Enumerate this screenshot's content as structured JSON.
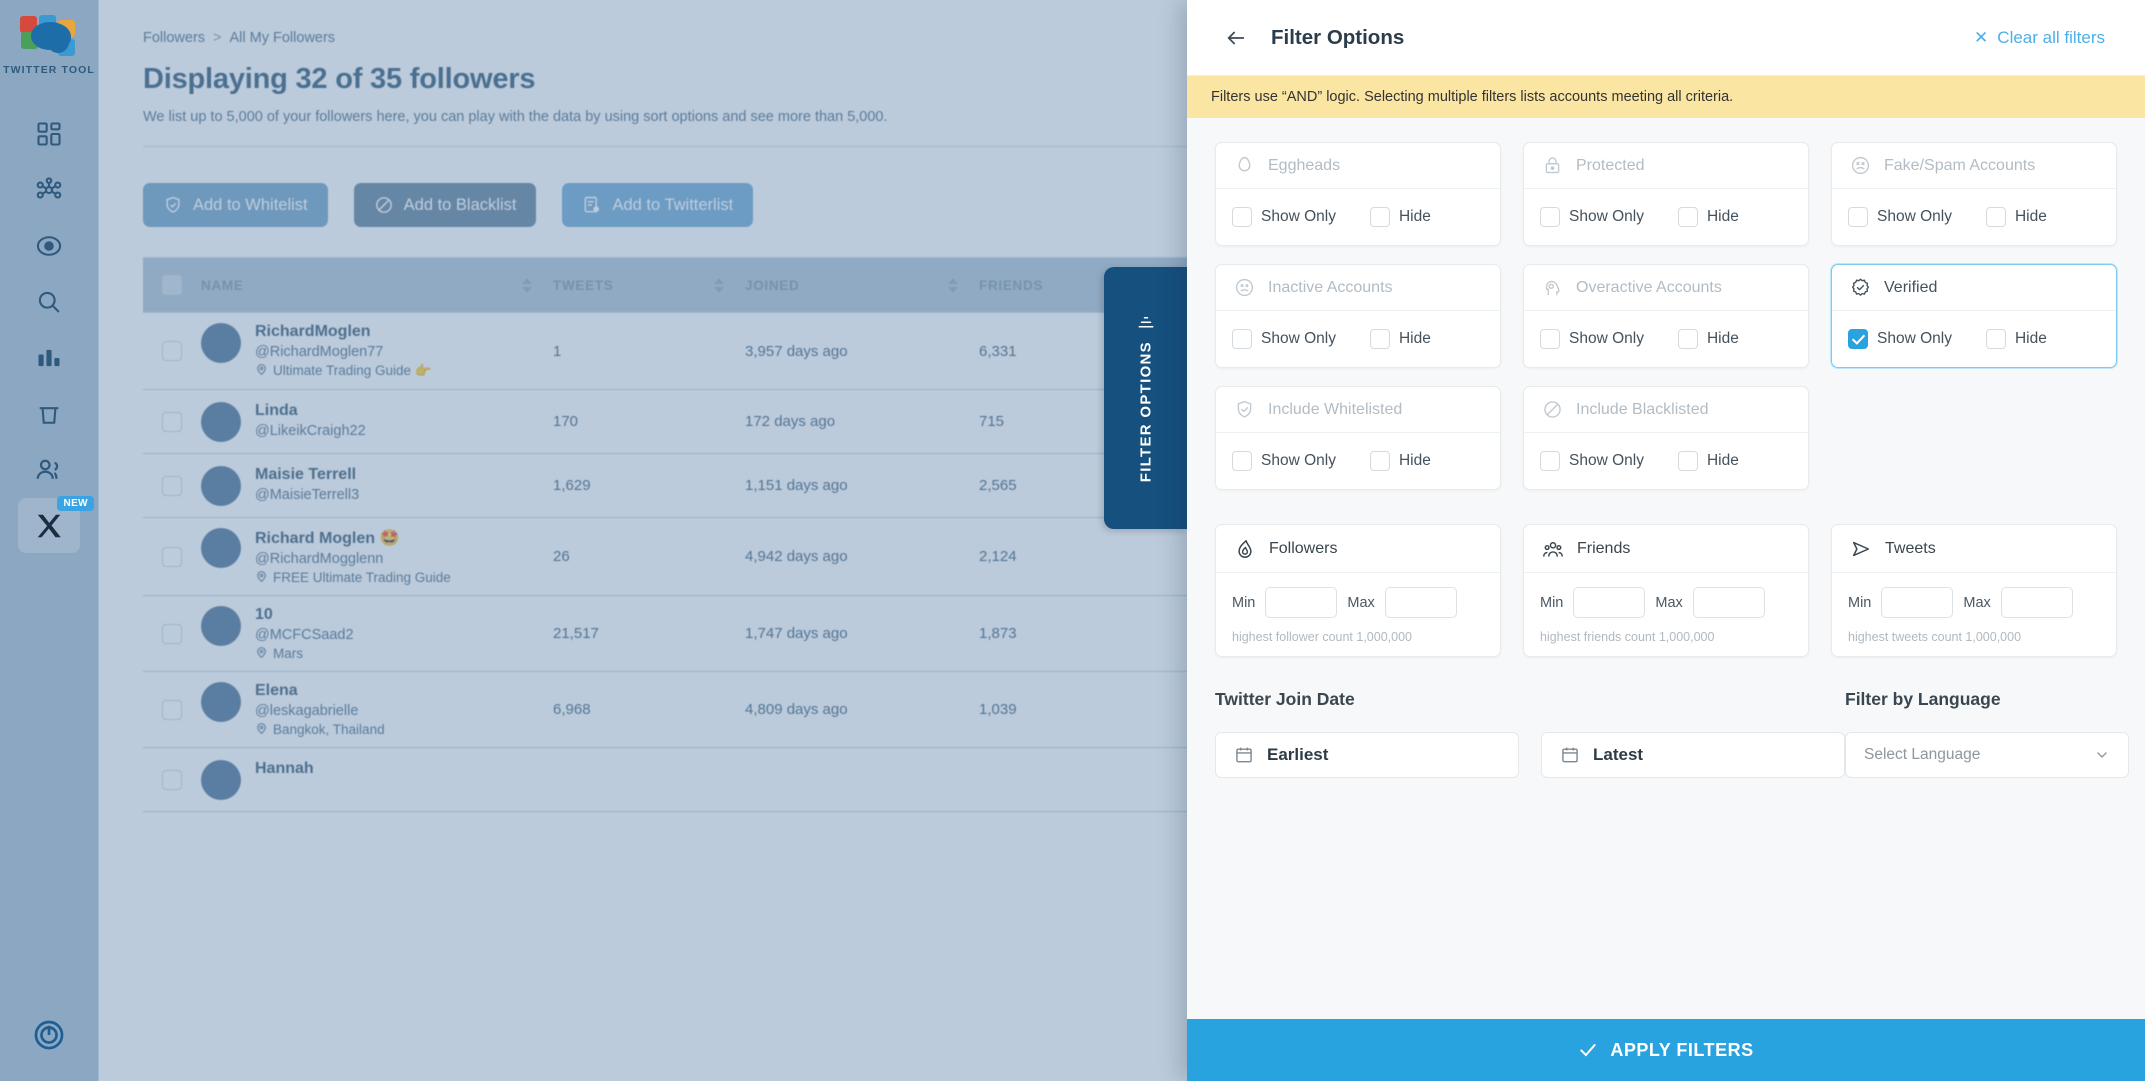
{
  "sidebar": {
    "brand": "TWITTER TOOL",
    "items": [
      {
        "name": "dashboard",
        "icon": "dashboard-icon"
      },
      {
        "name": "network",
        "icon": "network-icon"
      },
      {
        "name": "target",
        "icon": "target-icon"
      },
      {
        "name": "search",
        "icon": "search-icon"
      },
      {
        "name": "analytics",
        "icon": "bar-chart-icon"
      },
      {
        "name": "trash",
        "icon": "trash-icon"
      },
      {
        "name": "followers",
        "icon": "users-icon"
      },
      {
        "name": "x",
        "icon": "x-logo-icon",
        "badge": "NEW"
      }
    ],
    "power_icon": "power-icon"
  },
  "main": {
    "breadcrumb": {
      "root": "Followers",
      "separator": ">",
      "current": "All My Followers"
    },
    "title": "Displaying 32 of 35 followers",
    "subtitle": "We list up to 5,000 of your followers here, you can play with the data by using sort options and see more than 5,000.",
    "buttons": [
      {
        "label": "Add to Whitelist",
        "icon": "shield-check-icon",
        "color": "#6e9ec4"
      },
      {
        "label": "Add to Blacklist",
        "icon": "ban-icon",
        "color": "#5f7f9c"
      },
      {
        "label": "Add to Twitterlist",
        "icon": "list-add-icon",
        "color": "#6aa4d1"
      }
    ],
    "table": {
      "columns": [
        "NAME",
        "TWEETS",
        "JOINED",
        "FRIENDS"
      ],
      "rows": [
        {
          "name": "RichardMoglen",
          "handle": "@RichardMoglen77",
          "location": "Ultimate Trading Guide 👉",
          "tweets": "1",
          "joined": "3,957 days ago",
          "friends": "6,331",
          "dots": [
            "#e0a640",
            "#e04d5f"
          ]
        },
        {
          "name": "Linda",
          "handle": "@LikeikCraigh22",
          "location": "",
          "tweets": "170",
          "joined": "172 days ago",
          "friends": "715",
          "dots": []
        },
        {
          "name": "Maisie Terrell",
          "handle": "@MaisieTerrell3",
          "location": "",
          "tweets": "1,629",
          "joined": "1,151 days ago",
          "friends": "2,565",
          "dots": []
        },
        {
          "name": "Richard Moglen 🤩",
          "handle": "@RichardMogglenn",
          "location": "FREE Ultimate Trading Guide",
          "tweets": "26",
          "joined": "4,942 days ago",
          "friends": "2,124",
          "dots": [
            "#e0a640"
          ]
        },
        {
          "name": "10",
          "handle": "@MCFCSaad2",
          "location": "Mars",
          "tweets": "21,517",
          "joined": "1,747 days ago",
          "friends": "1,873",
          "dots": []
        },
        {
          "name": "Elena",
          "handle": "@leskagabrielle",
          "location": "Bangkok, Thailand",
          "tweets": "6,968",
          "joined": "4,809 days ago",
          "friends": "1,039",
          "dots": []
        },
        {
          "name": "Hannah",
          "handle": "",
          "location": "",
          "tweets": "",
          "joined": "",
          "friends": "",
          "dots": []
        }
      ]
    }
  },
  "filter_tab": {
    "label": "FILTER OPTIONS",
    "icon": "filter-icon"
  },
  "panel": {
    "back_icon": "arrow-left-icon",
    "title": "Filter Options",
    "clear_label": "Clear all filters",
    "clear_icon": "close-x-icon",
    "notice": "Filters use “AND” logic. Selecting multiple filters lists accounts meeting all criteria.",
    "checkbox_labels": {
      "show_only": "Show Only",
      "hide": "Hide"
    },
    "cards": [
      {
        "label": "Eggheads",
        "icon": "egg-icon",
        "selected": false,
        "show_only": false,
        "hide": false
      },
      {
        "label": "Protected",
        "icon": "lock-icon",
        "selected": false,
        "show_only": false,
        "hide": false
      },
      {
        "label": "Fake/Spam Accounts",
        "icon": "sad-face-icon",
        "selected": false,
        "show_only": false,
        "hide": false
      },
      {
        "label": "Inactive Accounts",
        "icon": "frown-icon",
        "selected": false,
        "show_only": false,
        "hide": false
      },
      {
        "label": "Overactive Accounts",
        "icon": "head-gear-icon",
        "selected": false,
        "show_only": false,
        "hide": false
      },
      {
        "label": "Verified",
        "icon": "verified-badge-icon",
        "selected": true,
        "show_only": true,
        "hide": false
      },
      {
        "label": "Include Whitelisted",
        "icon": "shield-check-icon",
        "selected": false,
        "show_only": false,
        "hide": false
      },
      {
        "label": "Include Blacklisted",
        "icon": "ban-icon",
        "selected": false,
        "show_only": false,
        "hide": false
      }
    ],
    "ranges": [
      {
        "label": "Followers",
        "icon": "flame-icon",
        "min_label": "Min",
        "max_label": "Max",
        "min_value": "",
        "max_value": "",
        "hint": "highest follower count 1,000,000"
      },
      {
        "label": "Friends",
        "icon": "friends-icon",
        "min_label": "Min",
        "max_label": "Max",
        "min_value": "",
        "max_value": "",
        "hint": "highest friends count 1,000,000"
      },
      {
        "label": "Tweets",
        "icon": "send-icon",
        "min_label": "Min",
        "max_label": "Max",
        "min_value": "",
        "max_value": "",
        "hint": "highest tweets count 1,000,000"
      }
    ],
    "join_date": {
      "title": "Twitter Join Date",
      "earliest_label": "Earliest",
      "latest_label": "Latest",
      "calendar_icon": "calendar-icon"
    },
    "language": {
      "title": "Filter by Language",
      "placeholder": "Select Language",
      "chevron_icon": "chevron-down-icon"
    },
    "apply_label": "APPLY FILTERS",
    "apply_icon": "check-icon",
    "accent": "#29a3e0",
    "notice_bg": "#fbe5a2"
  }
}
